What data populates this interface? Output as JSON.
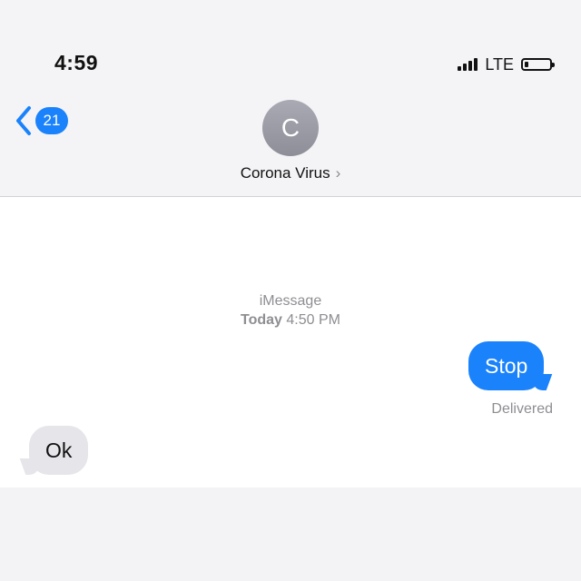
{
  "status_bar": {
    "time": "4:59",
    "network": "LTE",
    "battery_level": 0.15,
    "signal_bars": 4
  },
  "nav": {
    "back_icon": "chevron-left-icon",
    "unread_count": "21"
  },
  "contact": {
    "initial": "C",
    "name": "Corona Virus",
    "chevron": "›"
  },
  "conversation": {
    "service": "iMessage",
    "timestamp_day": "Today",
    "timestamp_time": "4:50 PM",
    "messages": [
      {
        "direction": "sent",
        "text": "Stop",
        "status": "Delivered"
      },
      {
        "direction": "received",
        "text": "Ok"
      }
    ]
  },
  "colors": {
    "accent": "#1a82fb",
    "received_bubble": "#e5e5ea",
    "meta_text": "#8e8e93"
  }
}
